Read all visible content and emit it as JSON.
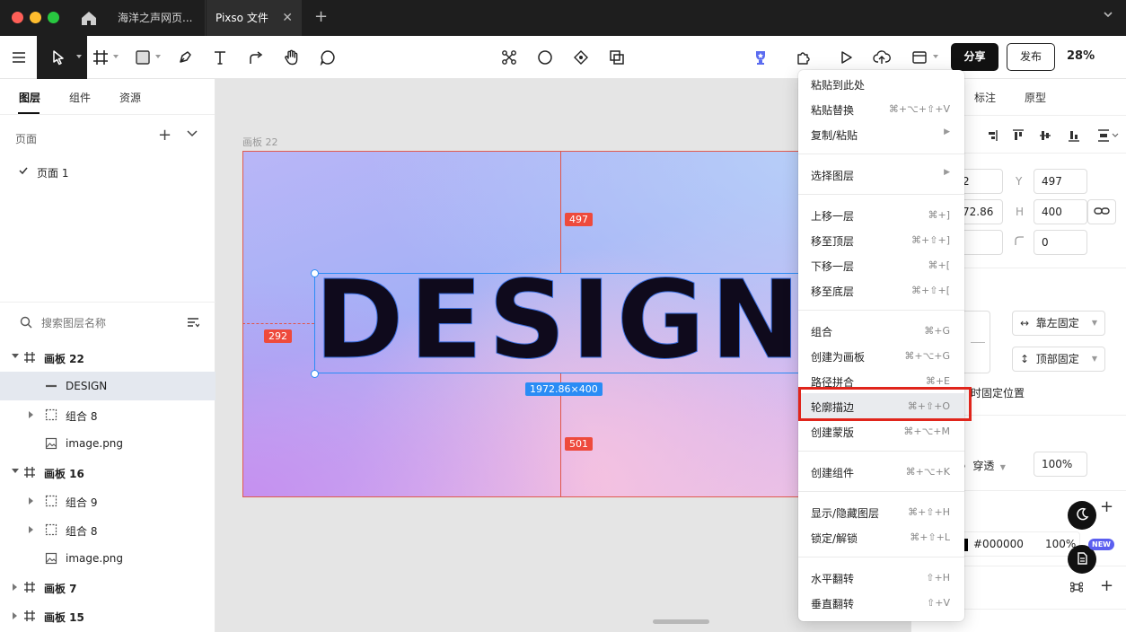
{
  "titlebar": {
    "tabs": [
      {
        "label": "海洋之声网页..."
      },
      {
        "label": "Pixso 文件"
      }
    ],
    "add_tab": "+",
    "close": "✕"
  },
  "toolbar": {
    "share_label": "分享",
    "publish_label": "发布",
    "zoom": "28%"
  },
  "left_panel": {
    "tabs": [
      "图层",
      "组件",
      "资源"
    ],
    "pages_title": "页面",
    "pages": [
      {
        "label": "页面 1",
        "selected": true
      }
    ],
    "search_placeholder": "搜索图层名称",
    "layers": [
      {
        "label": "画板 22",
        "type": "frame",
        "level": 0,
        "expanded": true
      },
      {
        "label": "DESIGN",
        "type": "text",
        "level": 1,
        "selected": true
      },
      {
        "label": "组合 8",
        "type": "group",
        "level": 1,
        "expanded": false
      },
      {
        "label": "image.png",
        "type": "image",
        "level": 1
      },
      {
        "label": "画板 16",
        "type": "frame",
        "level": 0,
        "expanded": true
      },
      {
        "label": "组合 9",
        "type": "group",
        "level": 1,
        "expanded": false
      },
      {
        "label": "组合 8",
        "type": "group",
        "level": 1,
        "expanded": false
      },
      {
        "label": "image.png",
        "type": "image",
        "level": 1
      },
      {
        "label": "画板 7",
        "type": "frame",
        "level": 0,
        "expanded": false
      },
      {
        "label": "画板 15",
        "type": "frame",
        "level": 0,
        "expanded": false
      }
    ]
  },
  "canvas": {
    "frame_label": "画板 22",
    "design_text": "DESIGN",
    "measure_top": "497",
    "measure_left": "292",
    "measure_bottom": "501",
    "size_label": "1972.86×400"
  },
  "right_panel": {
    "tabs": [
      "标注",
      "原型"
    ],
    "x_value": "2",
    "y_label": "Y",
    "y_value": "497",
    "w_value": "72.86",
    "h_label": "H",
    "h_value": "400",
    "radius_value": "0",
    "constraint_h": "靠左固定",
    "constraint_v": "顶部固定",
    "fixed_position": "时固定位置",
    "blend_mode": "穿透",
    "opacity": "100%",
    "fill_hex": "#000000",
    "fill_opacity": "100%",
    "new_badge": "NEW"
  },
  "context_menu": {
    "items": [
      {
        "label": "粘贴到此处",
        "shortcut": ""
      },
      {
        "label": "粘贴替换",
        "shortcut": "⌘+⌥+⇧+V"
      },
      {
        "label": "复制/粘贴",
        "shortcut": "",
        "submenu": true
      },
      {
        "label": "选择图层",
        "shortcut": "",
        "submenu": true
      },
      {
        "label": "上移一层",
        "shortcut": "⌘+]"
      },
      {
        "label": "移至顶层",
        "shortcut": "⌘+⇧+]"
      },
      {
        "label": "下移一层",
        "shortcut": "⌘+["
      },
      {
        "label": "移至底层",
        "shortcut": "⌘+⇧+["
      },
      {
        "label": "组合",
        "shortcut": "⌘+G"
      },
      {
        "label": "创建为画板",
        "shortcut": "⌘+⌥+G"
      },
      {
        "label": "路径拼合",
        "shortcut": "⌘+E"
      },
      {
        "label": "轮廓描边",
        "shortcut": "⌘+⇧+O",
        "highlighted": true
      },
      {
        "label": "创建蒙版",
        "shortcut": "⌘+⌥+M"
      },
      {
        "label": "创建组件",
        "shortcut": "⌘+⌥+K"
      },
      {
        "label": "显示/隐藏图层",
        "shortcut": "⌘+⇧+H"
      },
      {
        "label": "锁定/解锁",
        "shortcut": "⌘+⇧+L"
      },
      {
        "label": "水平翻转",
        "shortcut": "⇧+H"
      },
      {
        "label": "垂直翻转",
        "shortcut": "⇧+V"
      }
    ]
  },
  "colors": {
    "accent_blue": "#2a8cf5",
    "measure_red": "#ee4a3c",
    "highlight_red": "#e0251b",
    "titlebar": "#1e1e1e"
  }
}
